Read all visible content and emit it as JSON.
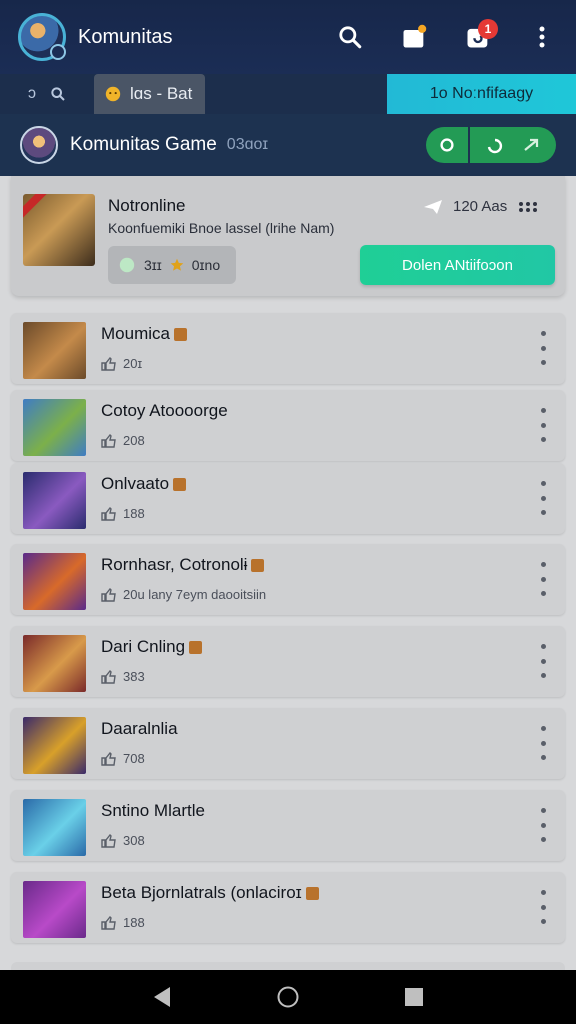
{
  "appbar": {
    "title": "Komunitas",
    "notification_count": "1"
  },
  "tabs": {
    "misc_label": "ɔ",
    "chat_label": "lɑs - Bat",
    "notifications_label": "1o Noːnfifaagy"
  },
  "community": {
    "title": "Komunitas Game",
    "subtitle": "03ɑoɪ"
  },
  "featured": {
    "name": "Notronline",
    "description": "Koonfuemiki Bnoe lassel (lrihe Nam)",
    "meta": "120 Aas",
    "stats_left": "3ɪɪ",
    "stats_right": "0ɪno",
    "join_label": "Dolen ANtiifoɔon"
  },
  "games": [
    {
      "name": "Moumica",
      "stat": "20ɪ",
      "crown": true,
      "colors": [
        "#6b4a2a",
        "#c48a4a"
      ],
      "ribbon": true
    },
    {
      "name": "Cotoy Atoooorge",
      "stat": "208",
      "crown": false,
      "colors": [
        "#3f7cc4",
        "#7cb04a"
      ],
      "ribbon": false
    },
    {
      "name": "Onlvaato",
      "stat": "188",
      "crown": true,
      "colors": [
        "#2a2c6e",
        "#8a5ac0"
      ],
      "ribbon": false
    },
    {
      "name": "Rornhasr, Cotronolɨ",
      "stat": "20u lany 7eym daooitsiin",
      "crown": true,
      "colors": [
        "#5a2a8a",
        "#d86a2a"
      ],
      "ribbon": false
    },
    {
      "name": "Dari Cnling",
      "stat": "383",
      "crown": true,
      "colors": [
        "#7a2a2a",
        "#d89a4a"
      ],
      "ribbon": false
    },
    {
      "name": "Daaralnlia",
      "stat": "708",
      "crown": false,
      "colors": [
        "#3a2a6a",
        "#d8a02a"
      ],
      "ribbon": false
    },
    {
      "name": "Sntino Mlartle",
      "stat": "308",
      "crown": false,
      "colors": [
        "#2a6aa8",
        "#6ad0e8"
      ],
      "ribbon": false
    },
    {
      "name": "Beta Bjornlatrals (onlaciroɪ",
      "stat": "188",
      "crown": true,
      "colors": [
        "#6a2a8a",
        "#b84ac8"
      ],
      "ribbon": false
    }
  ],
  "colors": {
    "appbar": "#1b2d55",
    "accent_teal": "#21c7a5",
    "accent_green": "#239b55",
    "notif_red": "#e53935"
  }
}
